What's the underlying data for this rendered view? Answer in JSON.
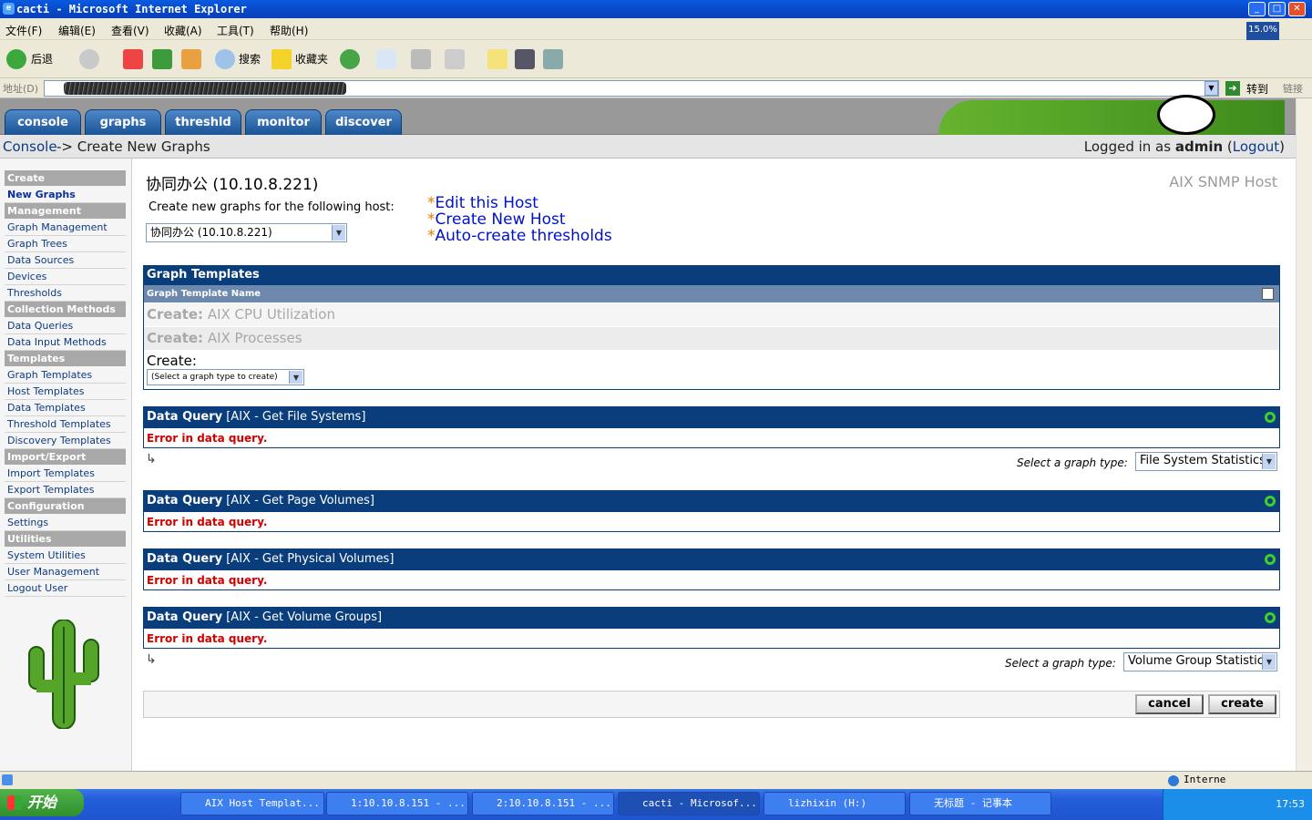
{
  "window": {
    "title": "cacti - Microsoft Internet Explorer",
    "zoom": "15.0%"
  },
  "menu": [
    "文件(F)",
    "编辑(E)",
    "查看(V)",
    "收藏(A)",
    "工具(T)",
    "帮助(H)"
  ],
  "toolbar": {
    "back_label": "后退",
    "search_label": "搜索",
    "favorites_label": "收藏夹"
  },
  "address": {
    "label": "地址(D)",
    "go_label": "转到",
    "links_label": "链接"
  },
  "tabs": [
    "console",
    "graphs",
    "threshld",
    "monitor",
    "discover"
  ],
  "breadcrumb": {
    "console_link": "Console",
    "current": " -> Create New Graphs"
  },
  "login": {
    "prefix": "Logged in as ",
    "user": "admin",
    "logout": "Logout"
  },
  "sidebar": [
    {
      "label": "Create",
      "type": "header"
    },
    {
      "label": "New Graphs",
      "type": "selected"
    },
    {
      "label": "Management",
      "type": "header"
    },
    {
      "label": "Graph Management",
      "type": "link"
    },
    {
      "label": "Graph Trees",
      "type": "link"
    },
    {
      "label": "Data Sources",
      "type": "link"
    },
    {
      "label": "Devices",
      "type": "link"
    },
    {
      "label": "Thresholds",
      "type": "link"
    },
    {
      "label": "Collection Methods",
      "type": "header"
    },
    {
      "label": "Data Queries",
      "type": "link"
    },
    {
      "label": "Data Input Methods",
      "type": "link"
    },
    {
      "label": "Templates",
      "type": "header"
    },
    {
      "label": "Graph Templates",
      "type": "link"
    },
    {
      "label": "Host Templates",
      "type": "link"
    },
    {
      "label": "Data Templates",
      "type": "link"
    },
    {
      "label": "Threshold Templates",
      "type": "link"
    },
    {
      "label": "Discovery Templates",
      "type": "link"
    },
    {
      "label": "Import/Export",
      "type": "header"
    },
    {
      "label": "Import Templates",
      "type": "link"
    },
    {
      "label": "Export Templates",
      "type": "link"
    },
    {
      "label": "Configuration",
      "type": "header"
    },
    {
      "label": "Settings",
      "type": "link"
    },
    {
      "label": "Utilities",
      "type": "header"
    },
    {
      "label": "System Utilities",
      "type": "link"
    },
    {
      "label": "User Management",
      "type": "link"
    },
    {
      "label": "Logout User",
      "type": "link"
    }
  ],
  "host": {
    "title": "协同办公 (10.10.8.221)",
    "template": "AIX SNMP Host",
    "prompt": "Create new graphs for the following host:",
    "selected": "协同办公 (10.10.8.221)"
  },
  "host_links": {
    "edit": "Edit this Host",
    "create": "Create New Host",
    "auto": "Auto-create thresholds"
  },
  "graph_templates": {
    "title": "Graph Templates",
    "column": "Graph Template Name",
    "rows": [
      {
        "prefix": "Create:",
        "name": "AIX CPU Utilization"
      },
      {
        "prefix": "Create:",
        "name": "AIX Processes"
      }
    ],
    "create_label": "Create:",
    "create_select": "(Select a graph type to create)"
  },
  "data_queries": [
    {
      "label": "Data Query",
      "name": "[AIX - Get File Systems]",
      "error": "Error in data query.",
      "graph_type": "File System Statistics"
    },
    {
      "label": "Data Query",
      "name": "[AIX - Get Page Volumes]",
      "error": "Error in data query."
    },
    {
      "label": "Data Query",
      "name": "[AIX - Get Physical Volumes]",
      "error": "Error in data query."
    },
    {
      "label": "Data Query",
      "name": "[AIX - Get Volume Groups]",
      "error": "Error in data query.",
      "graph_type": "Volume Group Statistics"
    }
  ],
  "select_graph_type_label": "Select a graph type:",
  "buttons": {
    "cancel": "cancel",
    "create": "create"
  },
  "statusbar": {
    "zone": "Interne"
  },
  "taskbar": {
    "start": "开始",
    "tasks": [
      "AIX Host Templat...",
      "1:10.10.8.151 - ...",
      "2:10.10.8.151 - ...",
      "cacti - Microsof...",
      "lizhixin (H:)",
      "无标题 - 记事本"
    ],
    "clock": "17:53"
  },
  "colors": {
    "brand_blue": "#0a3d7c",
    "error_red": "#d00000",
    "link_blue": "#0012c7"
  }
}
